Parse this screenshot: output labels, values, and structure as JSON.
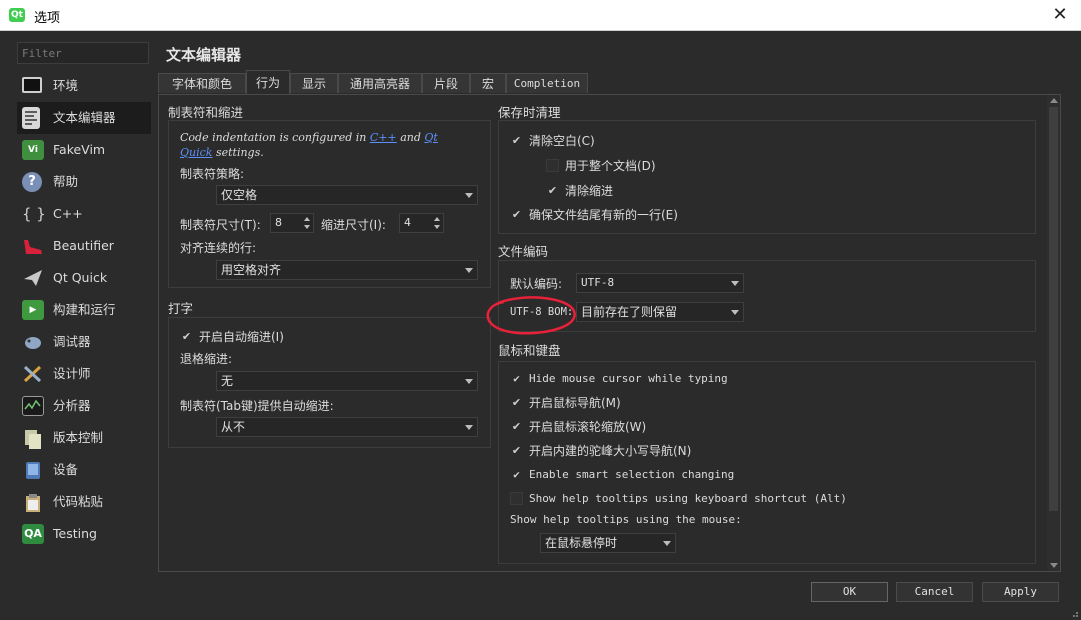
{
  "window": {
    "title": "选项",
    "app_icon": "Qt",
    "close": "✕"
  },
  "filter": {
    "placeholder": "Filter"
  },
  "nav": {
    "items": [
      {
        "label": "环境",
        "icon": "monitor-icon"
      },
      {
        "label": "文本编辑器",
        "icon": "text-editor-icon",
        "active": true
      },
      {
        "label": "FakeVim",
        "icon": "fakevim-icon"
      },
      {
        "label": "帮助",
        "icon": "help-icon"
      },
      {
        "label": "C++",
        "icon": "braces-icon"
      },
      {
        "label": "Beautifier",
        "icon": "beautifier-shoe-icon"
      },
      {
        "label": "Qt Quick",
        "icon": "qt-quick-plane-icon"
      },
      {
        "label": "构建和运行",
        "icon": "build-run-icon"
      },
      {
        "label": "调试器",
        "icon": "debugger-icon"
      },
      {
        "label": "设计师",
        "icon": "designer-icon"
      },
      {
        "label": "分析器",
        "icon": "analyzer-icon"
      },
      {
        "label": "版本控制",
        "icon": "version-control-icon"
      },
      {
        "label": "设备",
        "icon": "device-icon"
      },
      {
        "label": "代码粘贴",
        "icon": "code-paste-icon"
      },
      {
        "label": "Testing",
        "icon": "qa-testing-icon"
      }
    ]
  },
  "page": {
    "title": "文本编辑器"
  },
  "tabs": [
    "字体和颜色",
    "行为",
    "显示",
    "通用高亮器",
    "片段",
    "宏",
    "Completion"
  ],
  "indent": {
    "title": "制表符和缩进",
    "note_prefix": "Code indentation is configured in ",
    "note_link1": "C++",
    "note_mid": " and ",
    "note_link2a": "Qt",
    "note_link2b": "Quick",
    "note_suffix": " settings.",
    "tab_policy_label": "制表符策略:",
    "tab_policy_value": "仅空格",
    "tab_size_label": "制表符尺寸(T):",
    "tab_size_value": "8",
    "indent_size_label": "缩进尺寸(I):",
    "indent_size_value": "4",
    "align_label": "对齐连续的行:",
    "align_value": "用空格对齐"
  },
  "typing": {
    "title": "打字",
    "auto_indent": "开启自动缩进(I)",
    "backspace_label": "退格缩进:",
    "backspace_value": "无",
    "tab_key_label": "制表符(Tab键)提供自动缩进:",
    "tab_key_value": "从不"
  },
  "cleanup": {
    "title": "保存时清理",
    "clean_whitespace": "清除空白(C)",
    "entire_document": "用于整个文档(D)",
    "clean_indent": "清除缩进",
    "ensure_newline": "确保文件结尾有新的一行(E)"
  },
  "encoding": {
    "title": "文件编码",
    "default_label": "默认编码:",
    "default_value": "UTF-8",
    "bom_label": "UTF-8 BOM:",
    "bom_value": "目前存在了则保留"
  },
  "mouse": {
    "title": "鼠标和键盘",
    "hide_cursor": "Hide mouse cursor while typing",
    "mouse_nav": "开启鼠标导航(M)",
    "scroll_zoom": "开启鼠标滚轮缩放(W)",
    "camel_nav": "开启内建的驼峰大小写导航(N)",
    "smart_sel": "Enable smart selection changing",
    "kbd_tooltip": "Show help tooltips using keyboard shortcut (Alt)",
    "tooltip_mouse_label": "Show help tooltips using the mouse:",
    "tooltip_mouse_value": "在鼠标悬停时"
  },
  "buttons": {
    "ok": "OK",
    "cancel": "Cancel",
    "apply": "Apply"
  },
  "colors": {
    "background": "#2b2b2b",
    "link": "#5b8ff9",
    "highlight_circle": "#e8213a"
  }
}
